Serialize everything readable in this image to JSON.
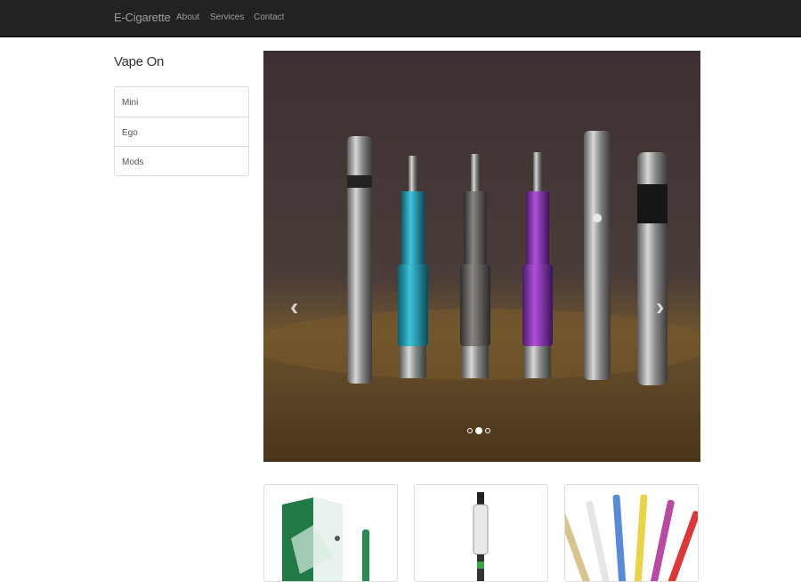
{
  "navbar": {
    "brand": "E-Cigarette",
    "links": [
      "About",
      "Services",
      "Contact"
    ]
  },
  "sidebar": {
    "title": "Vape On",
    "items": [
      "Mini",
      "Ego",
      "Mods"
    ]
  },
  "carousel": {
    "prev_glyph": "‹",
    "next_glyph": "›",
    "slide_count": 3,
    "active_index": 1,
    "image": "photo-of-six-e-cigarettes-on-wooden-table"
  },
  "thumbnails": [
    {
      "image": "green-ego-box-and-pen"
    },
    {
      "image": "clear-tank-clearomizer"
    },
    {
      "image": "colorful-clearomizers-fan"
    }
  ],
  "colors": {
    "navbar_bg": "#222222",
    "navbar_text": "#9d9d9d",
    "border": "#dddddd"
  }
}
